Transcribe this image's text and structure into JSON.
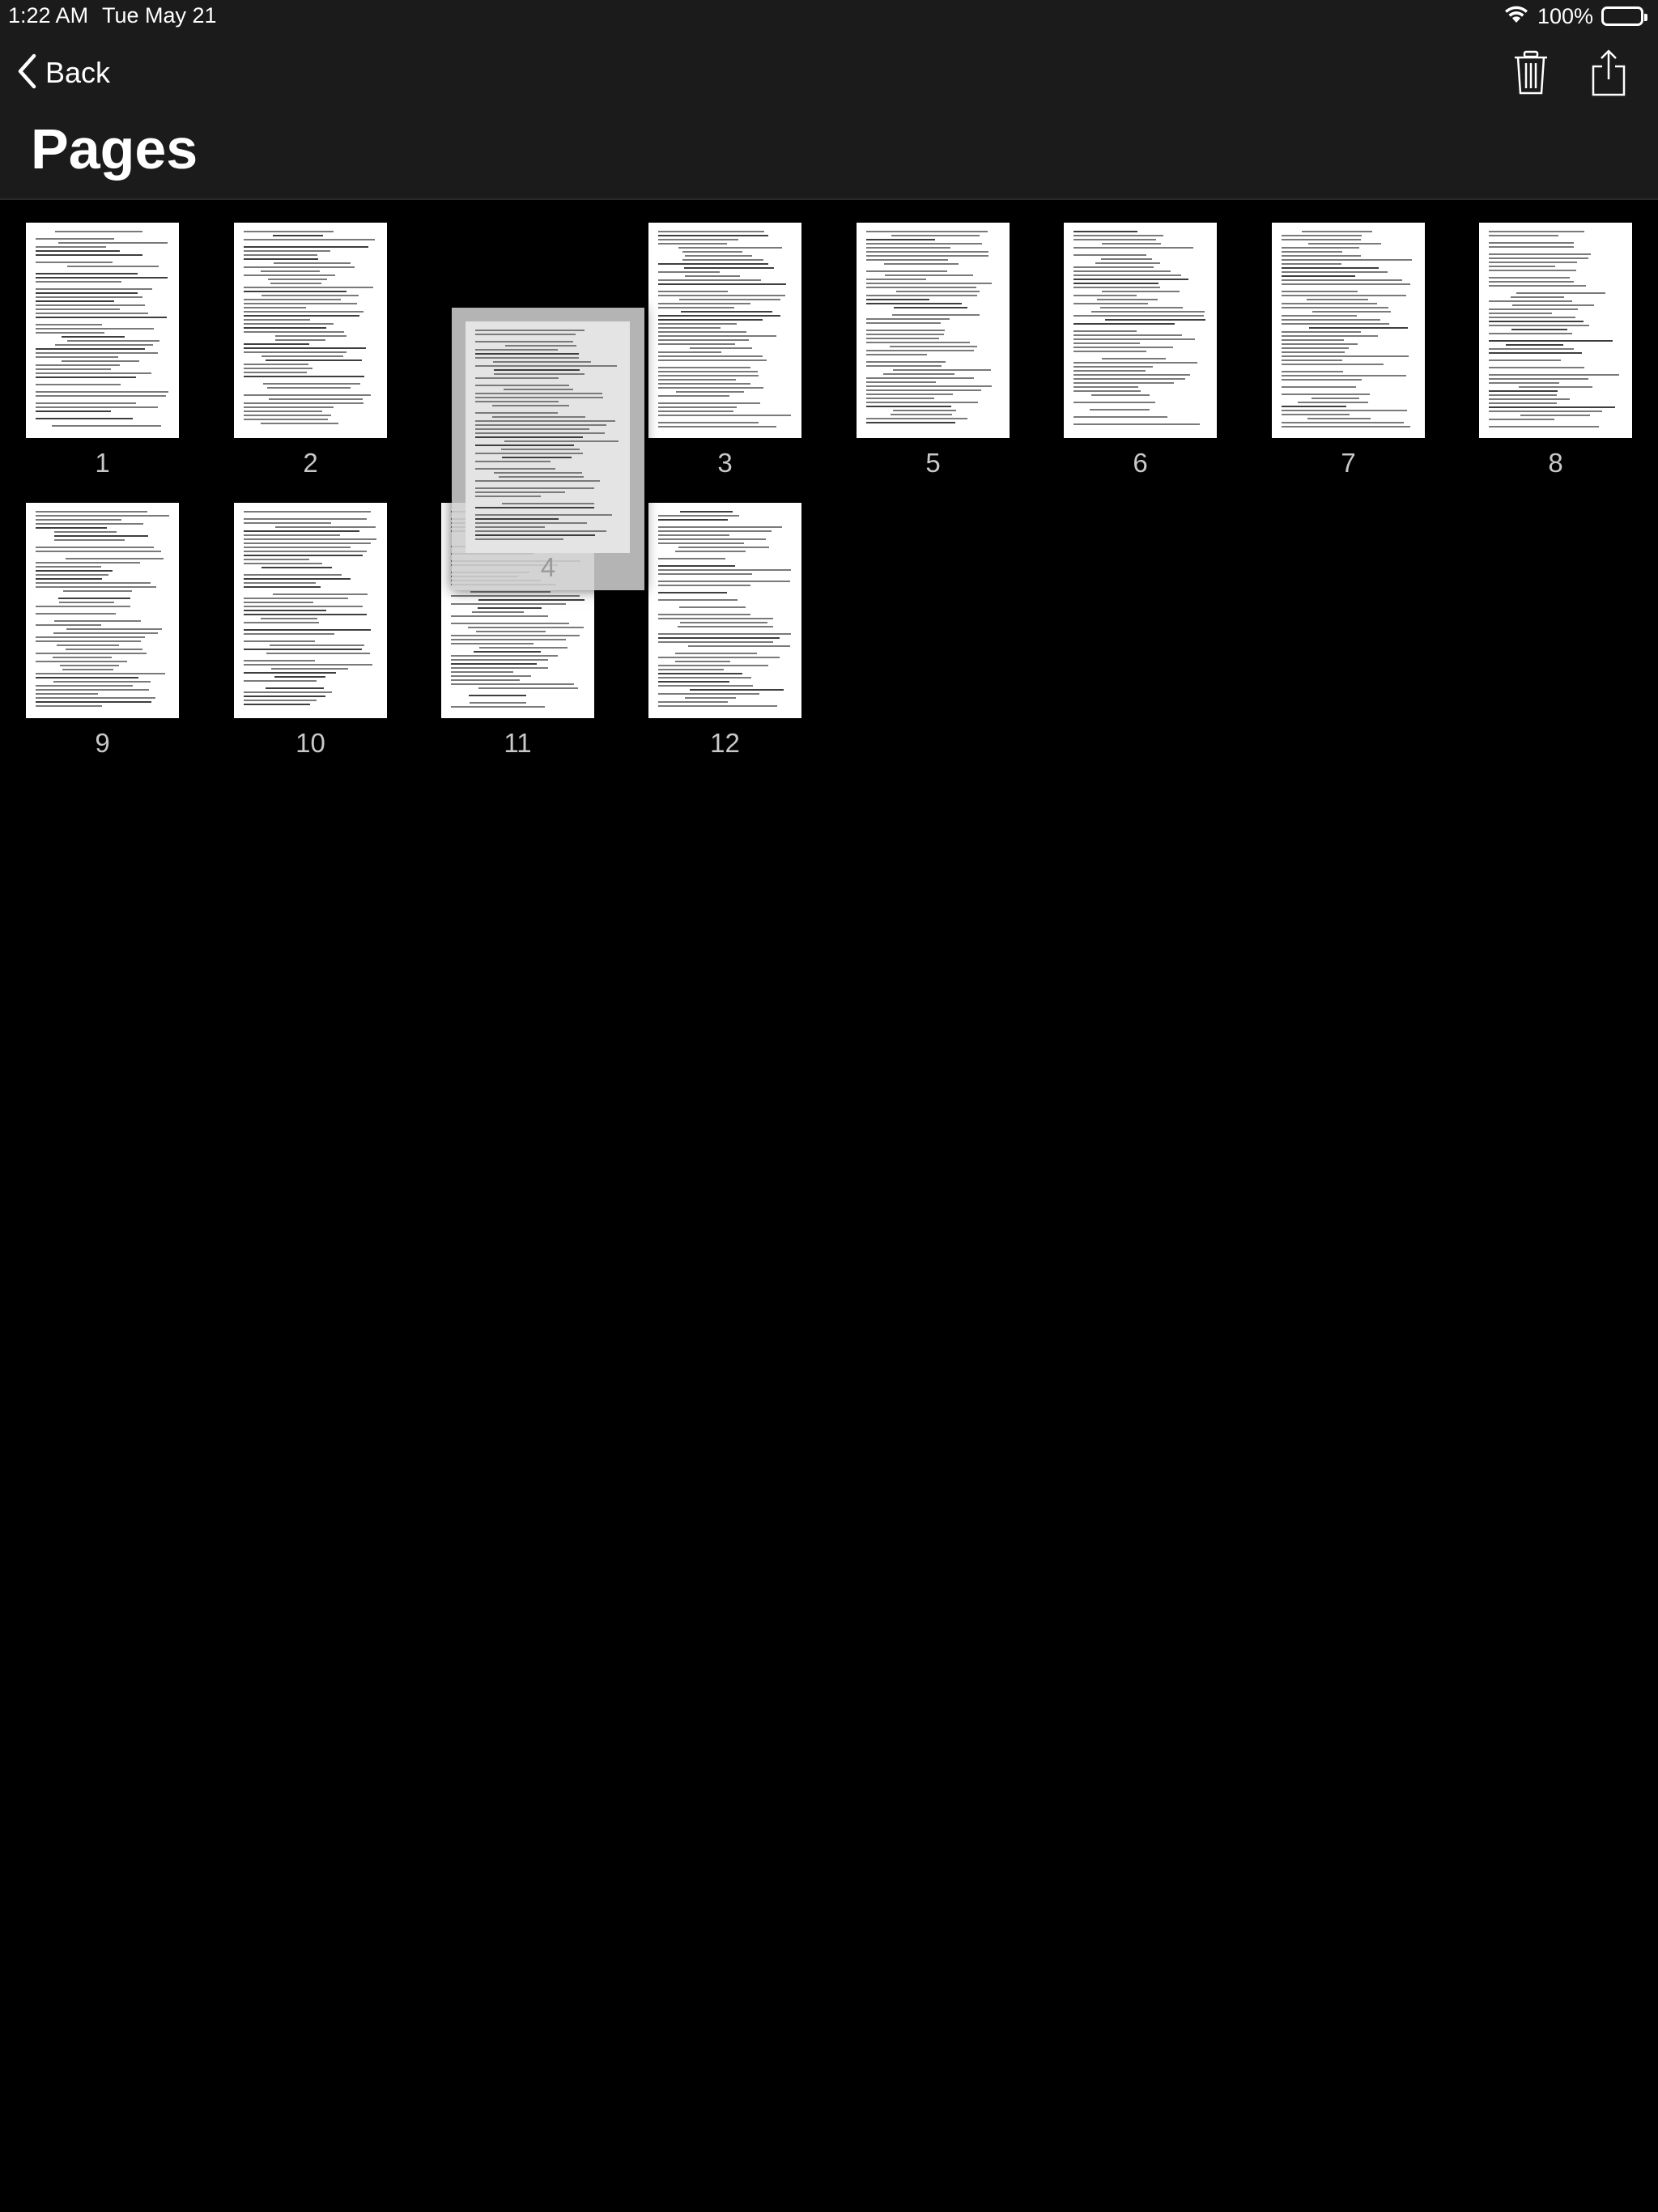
{
  "status_bar": {
    "time": "1:22 AM",
    "date": "Tue May 21",
    "battery": "100%"
  },
  "nav": {
    "back_label": "Back",
    "trash_icon": "trash-icon",
    "share_icon": "share-icon"
  },
  "title": "Pages",
  "pages": [
    {
      "label": "1"
    },
    {
      "label": "2"
    },
    {
      "label": "3"
    },
    {
      "label": "5"
    },
    {
      "label": "6"
    },
    {
      "label": "7"
    },
    {
      "label": "8"
    },
    {
      "label": "9"
    },
    {
      "label": "10"
    },
    {
      "label": "11"
    },
    {
      "label": "12"
    }
  ],
  "dragging_page": {
    "label": "4"
  }
}
